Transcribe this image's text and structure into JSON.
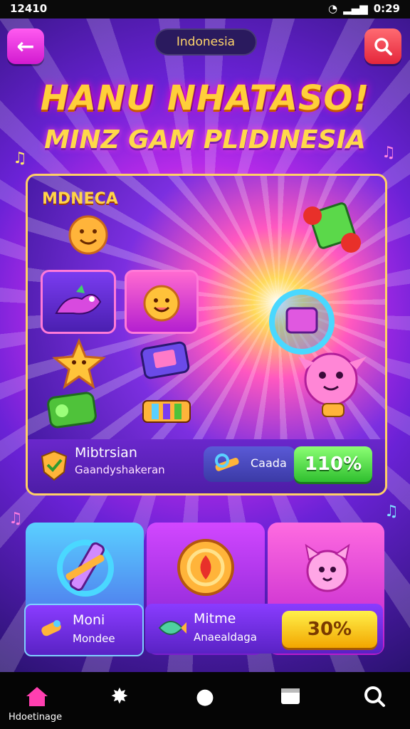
{
  "status_bar": {
    "time_left": "12410",
    "time_right": "0:29"
  },
  "header": {
    "region_pill": "Indonesia",
    "title": "HANU NHATASO!",
    "subtitle": "MINZ GAM PLIDINESIA"
  },
  "main_card": {
    "label": "MDNECA",
    "footer": {
      "title": "Mibtrsian",
      "subtitle": "Gaandyshakeran",
      "chip_label": "Caada",
      "button_label": "110%"
    }
  },
  "bottom_cards": {
    "left": {
      "title": "Moni",
      "subtitle": "Mondee"
    },
    "right": {
      "title": "Mitme",
      "subtitle": "Anaealdaga",
      "button_label": "30%"
    }
  },
  "nav": {
    "home_label": "Hdoetinage"
  },
  "colors": {
    "accent_purple": "#7c2fe0",
    "accent_yellow": "#ffd44a",
    "cta_green": "#2fbf2f",
    "cta_yellow": "#f2a600"
  }
}
